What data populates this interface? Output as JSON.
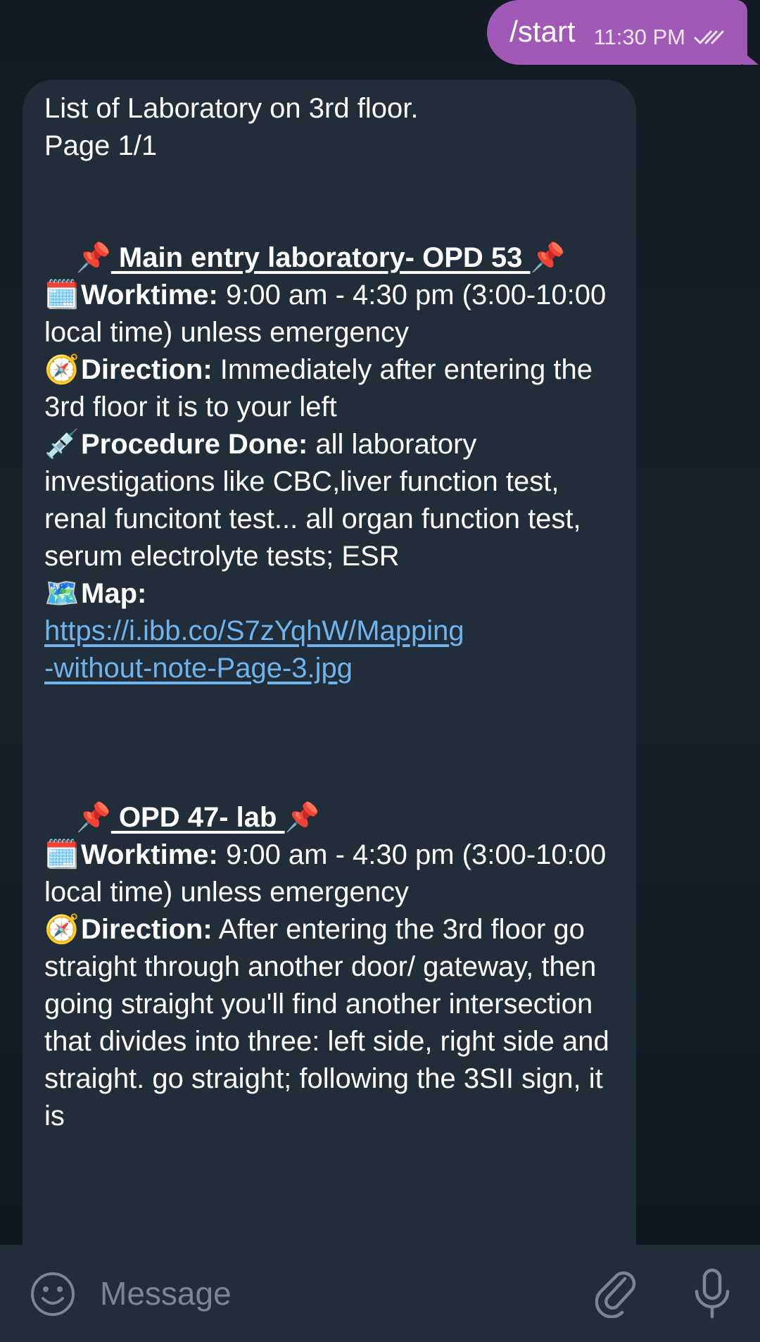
{
  "outgoing": {
    "text": "/start",
    "time": "11:30 PM",
    "status_icon": "double-check-icon"
  },
  "incoming": {
    "header_line1": "List of Laboratory on 3rd floor.",
    "header_line2": "Page 1/1",
    "entries": [
      {
        "pin": "📌",
        "title": " Main entry laboratory- OPD 53 ",
        "worktime_emoji": "🗓️",
        "worktime_label": "Worktime:",
        "worktime_value": " 9:00 am - 4:30 pm (3:00-10:00 local time) unless emergency",
        "direction_emoji": "🧭",
        "direction_label": "Direction:",
        "direction_value": " Immediately after entering the 3rd floor it is to your left",
        "procedure_emoji": "💉",
        "procedure_label": "Procedure Done:",
        "procedure_value": " all laboratory investigations like CBC,liver function test, renal funcitont test... all organ function test, serum electrolyte tests; ESR",
        "map_emoji": "🗺️",
        "map_label": "Map:",
        "map_link_line1": "https://i.ibb.co/S7zYqhW/Mapping",
        "map_link_line2": "-without-note-Page-3.jpg"
      },
      {
        "pin": "📌",
        "title": " OPD 47- lab ",
        "worktime_emoji": "🗓️",
        "worktime_label": "Worktime:",
        "worktime_value": " 9:00 am - 4:30 pm (3:00-10:00 local time) unless emergency",
        "direction_emoji": "🧭",
        "direction_label": "Direction:",
        "direction_value": " After entering the 3rd floor go straight through another door/ gateway, then going straight you'll find another intersection that divides into three: left side, right side and straight. go straight; following the 3SII sign, it is"
      }
    ]
  },
  "input": {
    "placeholder": "Message",
    "emoji_icon": "smiley-icon",
    "attach_icon": "paperclip-icon",
    "mic_icon": "microphone-icon"
  },
  "colors": {
    "outgoing_bubble": "#a159b8",
    "incoming_bubble": "#222d3a",
    "link": "#6fb4ec",
    "background": "#111822"
  }
}
